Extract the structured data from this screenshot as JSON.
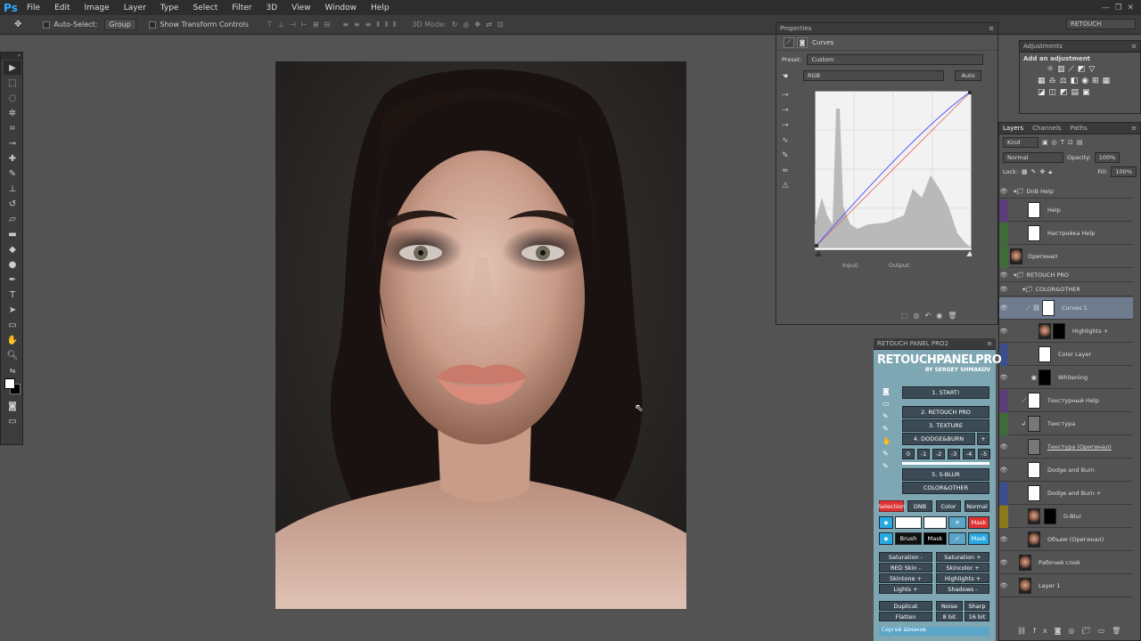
{
  "menu": {
    "logo": "Ps",
    "items": [
      "File",
      "Edit",
      "Image",
      "Layer",
      "Type",
      "Select",
      "Filter",
      "3D",
      "View",
      "Window",
      "Help"
    ]
  },
  "options": {
    "auto_select": "Auto-Select:",
    "group": "Group",
    "show_transform": "Show Transform Controls",
    "mode3d": "3D Mode:",
    "workspace": "RETOUCH"
  },
  "properties": {
    "tab": "Properties",
    "title": "Curves",
    "preset_label": "Preset:",
    "preset_value": "Custom",
    "channel": "RGB",
    "auto": "Auto",
    "input_label": "Input:",
    "output_label": "Output:"
  },
  "adjustments": {
    "tab": "Adjustments",
    "title": "Add an adjustment"
  },
  "layers": {
    "tabs": [
      "Layers",
      "Channels",
      "Paths"
    ],
    "kind": "Kind",
    "blend": "Normal",
    "opacity_label": "Opacity:",
    "opacity": "100%",
    "lock_label": "Lock:",
    "fill_label": "Fill:",
    "fill": "100%",
    "items": [
      {
        "name": "DnB Help"
      },
      {
        "name": "Help"
      },
      {
        "name": "Настройка Help"
      },
      {
        "name": "Оригинал"
      },
      {
        "name": "RETOUCH PRO"
      },
      {
        "name": "COLOR&OTHER"
      },
      {
        "name": "Curves 1"
      },
      {
        "name": "Highlights +"
      },
      {
        "name": "Color Layer"
      },
      {
        "name": "Whitening"
      },
      {
        "name": "Текстурный Help"
      },
      {
        "name": "Текстура"
      },
      {
        "name": "Текстура (Оригинал)"
      },
      {
        "name": "Dodge and Burn"
      },
      {
        "name": "Dodge and Burn +"
      },
      {
        "name": "G-Blur"
      },
      {
        "name": "Объем (Оригинал)"
      },
      {
        "name": "Рабочий слой"
      },
      {
        "name": "Layer 1"
      }
    ]
  },
  "rpp": {
    "tab": "RETOUCH PANEL PRO2",
    "logo": "RETOUCHPANELPRO",
    "by": "BY SERGEY SHMAKOV",
    "start": "1. START!",
    "retouch": "2. RETOUCH PRO",
    "texture": "3. TEXTURE",
    "dodge": "4. DODGE&BURN",
    "plus": "+",
    "nums": [
      "0",
      "-1",
      "-2",
      "-3",
      "-4",
      "-5"
    ],
    "sblur": "5. S-BLUR",
    "color_other": "COLOR&OTHER",
    "mode_buttons": [
      "Selection",
      "DNB",
      "Color",
      "Normal"
    ],
    "mask_a": "Mask",
    "brush": "Brush",
    "mask_b": "Mask",
    "mask_c": "Mask",
    "adj": [
      [
        "Saturation -",
        "Saturation +"
      ],
      [
        "RED Skin -",
        "Skincolor +"
      ],
      [
        "Skintone +",
        "Highlights +"
      ],
      [
        "Lights +",
        "Shadows -"
      ]
    ],
    "duplicat": "Duplicat",
    "flatten": "Flatten",
    "noise": "Noise",
    "sharp": "Sharp",
    "bit8": "8 bit",
    "bit16": "16 bit",
    "author": "Сергей Шмаков"
  }
}
